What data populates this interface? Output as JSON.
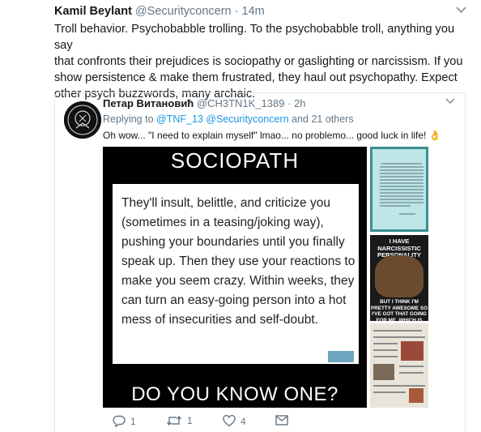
{
  "tweet": {
    "display_name": "Kamil Beylant",
    "handle": "@Securityconcern",
    "separator": "·",
    "time": "14m",
    "text": "Troll behavior.  Psychobabble trolling.  To the psychobabble troll, anything you say\nthat confronts their prejudices is sociopathy or gaslighting or narcissism. If you\nshow persistence & make them frustrated, they haul out psychopathy.  Expect\nother psych buzzwords, many archaic."
  },
  "quoted": {
    "display_name": "Петар Витановић",
    "handle": "@CH3TN1K_1389",
    "separator": "·",
    "time": "2h",
    "replying_prefix": "Replying to ",
    "replying_users": "@TNF_13 @Securityconcern",
    "replying_suffix": " and 21 others",
    "text": "Oh wow... \"I need to explain myself\" lmao... no problemo... good luck in life! 👌",
    "media": {
      "main_title": "SOCIOPATH",
      "main_body": "They'll insult, belittle, and criticize you (sometimes in a teasing/joking way), pushing your boundaries until you finally speak up. Then they use your reactions to make you seem crazy. Within weeks, they can turn an easy-going person into a hot mess of insecurities and self-doubt.",
      "main_bottom": "DO YOU KNOW ONE?",
      "meme_top": "I HAVE NARCISSISTIC PERSONALITY DISORDER",
      "meme_bottom": "BUT I THINK I'M PRETTY AWESOME SO I'VE GOT THAT GOING FOR ME, WHICH IS NICE"
    },
    "actions": {
      "reply_count": "1",
      "retweet_count": "1",
      "like_count": "4"
    }
  },
  "icons": [
    "chevron-down-icon",
    "reply-icon",
    "retweet-icon",
    "heart-icon",
    "message-icon"
  ],
  "colors": {
    "link": "#1b95e0",
    "meta": "#657786",
    "border": "#e1e8ed"
  }
}
